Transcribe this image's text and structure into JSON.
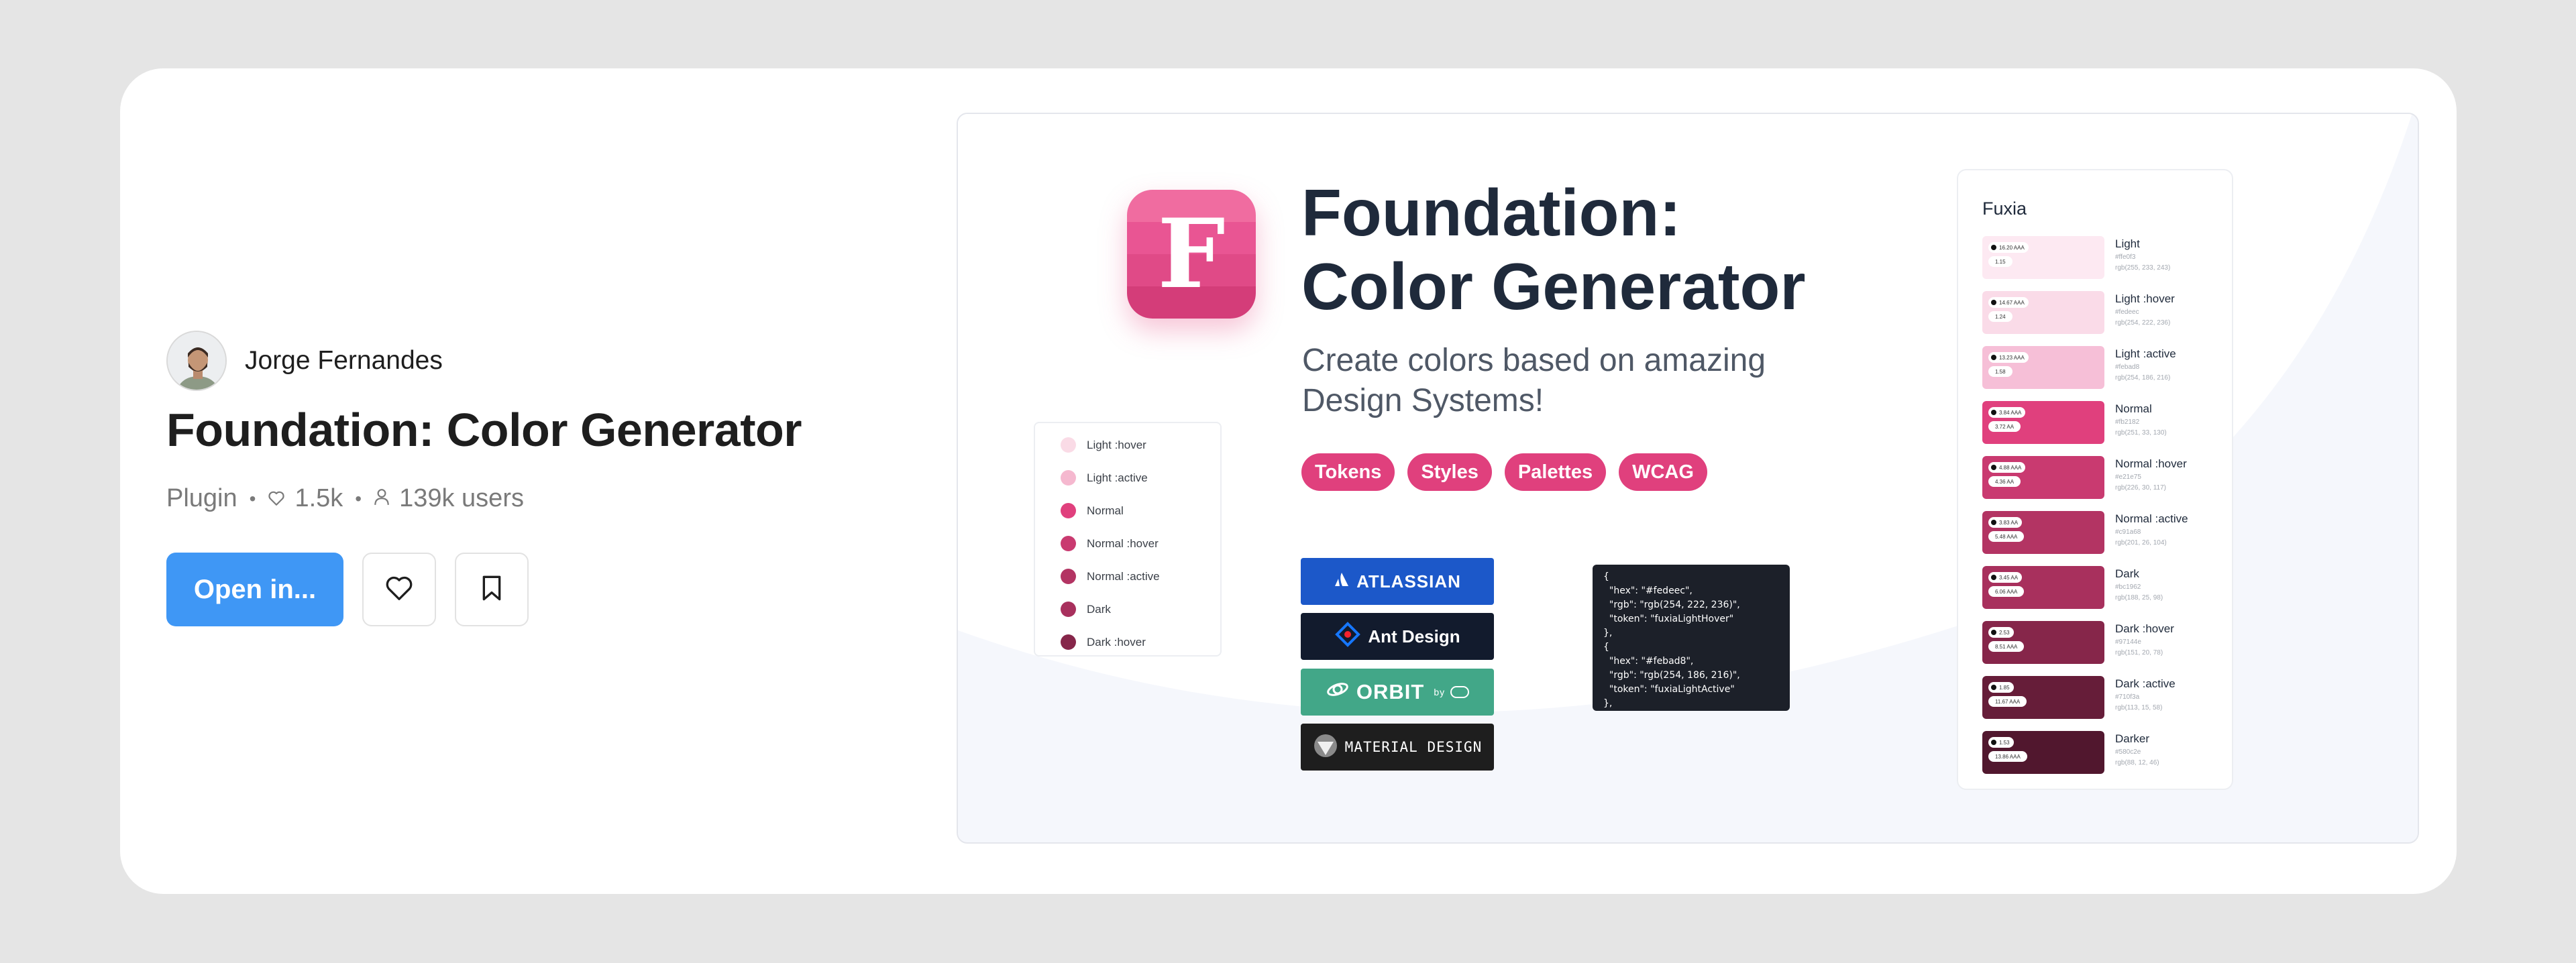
{
  "author": {
    "name": "Jorge Fernandes"
  },
  "plugin": {
    "title": "Foundation: Color Generator",
    "type": "Plugin",
    "likes": "1.5k",
    "users": "139k users"
  },
  "actions": {
    "open_label": "Open in..."
  },
  "cover": {
    "title_line1": "Foundation:",
    "title_line2": "Color Generator",
    "subtitle": "Create colors based on amazing Design Systems!",
    "app_icon_letter": "F",
    "tags": [
      "Tokens",
      "Styles",
      "Palettes",
      "WCAG"
    ],
    "list_items": [
      {
        "label": "Light :hover",
        "color": "#fadbe6"
      },
      {
        "label": "Light :active",
        "color": "#f5b8cf"
      },
      {
        "label": "Normal",
        "color": "#e0407d"
      },
      {
        "label": "Normal :hover",
        "color": "#c93a70"
      },
      {
        "label": "Normal :active",
        "color": "#b33463"
      },
      {
        "label": "Dark",
        "color": "#a8305d"
      },
      {
        "label": "Dark :hover",
        "color": "#86264a"
      }
    ],
    "logos": {
      "atlassian": "ATLASSIAN",
      "ant": "Ant Design",
      "orbit": "ORBIT",
      "orbit_by": "by",
      "material": "MATERIAL DESIGN"
    },
    "code": "{\n  \"hex\": \"#fedeec\",\n  \"rgb\": \"rgb(254, 222, 236)\",\n  \"token\": \"fuxiaLightHover\"\n},\n{\n  \"hex\": \"#febad8\",\n  \"rgb\": \"rgb(254, 186, 216)\",\n  \"token\": \"fuxiaLightActive\"\n},",
    "palette": {
      "name": "Fuxia",
      "swatches": [
        {
          "name": "Light",
          "hex": "#ffe0f3",
          "rgb": "rgb(255, 233, 243)",
          "color": "#fde9f2",
          "ratio1": "16.20 AAA",
          "ratio2": "1.15"
        },
        {
          "name": "Light :hover",
          "hex": "#fedeec",
          "rgb": "rgb(254, 222, 236)",
          "color": "#fadbe8",
          "ratio1": "14.67 AAA",
          "ratio2": "1.24"
        },
        {
          "name": "Light :active",
          "hex": "#febad8",
          "rgb": "rgb(254, 186, 216)",
          "color": "#f6bfd7",
          "ratio1": "13.23 AAA",
          "ratio2": "1.58"
        },
        {
          "name": "Normal",
          "hex": "#fb2182",
          "rgb": "rgb(251, 33, 130)",
          "color": "#e0407d",
          "ratio1": "3.84 AAA",
          "ratio2": "3.72 AA"
        },
        {
          "name": "Normal :hover",
          "hex": "#e21e75",
          "rgb": "rgb(226, 30, 117)",
          "color": "#c93a70",
          "ratio1": "4.88 AAA",
          "ratio2": "4.36 AA"
        },
        {
          "name": "Normal :active",
          "hex": "#c91a68",
          "rgb": "rgb(201, 26, 104)",
          "color": "#b33463",
          "ratio1": "3.83 AA",
          "ratio2": "5.48 AAA"
        },
        {
          "name": "Dark",
          "hex": "#bc1962",
          "rgb": "rgb(188, 25, 98)",
          "color": "#a8305d",
          "ratio1": "3.45 AA",
          "ratio2": "6.06 AAA"
        },
        {
          "name": "Dark :hover",
          "hex": "#97144e",
          "rgb": "rgb(151, 20, 78)",
          "color": "#86264a",
          "ratio1": "2.53",
          "ratio2": "8.51 AAA"
        },
        {
          "name": "Dark :active",
          "hex": "#710f3a",
          "rgb": "rgb(113, 15, 58)",
          "color": "#661d39",
          "ratio1": "1.85",
          "ratio2": "11.67 AAA"
        },
        {
          "name": "Darker",
          "hex": "#580c2e",
          "rgb": "rgb(88, 12, 46)",
          "color": "#51172e",
          "ratio1": "1.53",
          "ratio2": "13.86 AAA"
        }
      ]
    }
  }
}
